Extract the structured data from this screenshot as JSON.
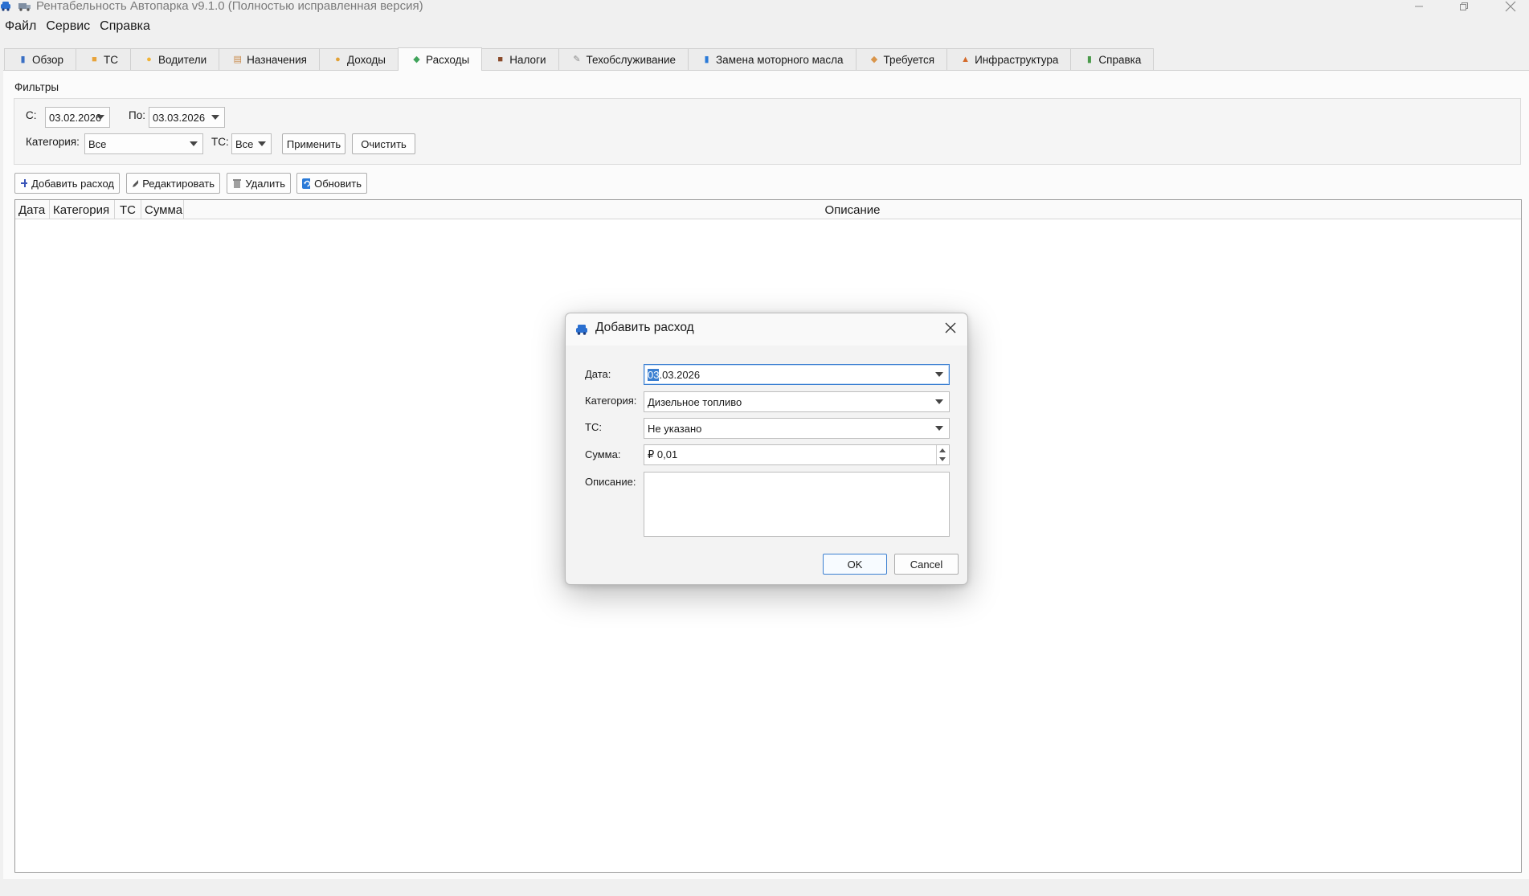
{
  "window": {
    "title": "Рентабельность Автопарка v9.1.0 (Полностью исправленная версия)"
  },
  "menu": [
    "Файл",
    "Сервис",
    "Справка"
  ],
  "tabs": [
    {
      "label": "Обзор",
      "icon": "chart-icon",
      "color": "#3a6fc4"
    },
    {
      "label": "ТС",
      "icon": "truck-icon",
      "color": "#e8a33a"
    },
    {
      "label": "Водители",
      "icon": "driver-face-icon",
      "color": "#f1b336"
    },
    {
      "label": "Назначения",
      "icon": "clipboard-icon",
      "color": "#c98a4a"
    },
    {
      "label": "Доходы",
      "icon": "money-bag-icon",
      "color": "#e2a237"
    },
    {
      "label": "Расходы",
      "icon": "money-wings-icon",
      "color": "#3fa35a"
    },
    {
      "label": "Налоги",
      "icon": "briefcase-icon",
      "color": "#8a4a2a"
    },
    {
      "label": "Техобслуживание",
      "icon": "wrench-icon",
      "color": "#8a8a8a"
    },
    {
      "label": "Замена моторного масла",
      "icon": "oil-can-icon",
      "color": "#2a7ad8"
    },
    {
      "label": "Требуется",
      "icon": "package-icon",
      "color": "#d9954a"
    },
    {
      "label": "Инфраструктура",
      "icon": "building-icon",
      "color": "#d46a2a"
    },
    {
      "label": "Справка",
      "icon": "books-icon",
      "color": "#4a9a4a"
    }
  ],
  "active_tab": 5,
  "filters": {
    "title": "Фильтры",
    "from_label": "С:",
    "from_value": "03.02.2026",
    "to_label": "По:",
    "to_value": "03.03.2026",
    "category_label": "Категория:",
    "category_value": "Все",
    "vehicle_label": "ТС:",
    "vehicle_value": "Все",
    "apply_label": "Применить",
    "clear_label": "Очистить"
  },
  "toolbar": {
    "add_label": "Добавить расход",
    "edit_label": "Редактировать",
    "delete_label": "Удалить",
    "refresh_label": "Обновить"
  },
  "table": {
    "columns": [
      "Дата",
      "Категория",
      "ТС",
      "Сумма",
      "Описание"
    ],
    "rows": []
  },
  "dialog": {
    "title": "Добавить расход",
    "date_label": "Дата:",
    "date_selected": "03",
    "date_rest": ".03.2026",
    "category_label": "Категория:",
    "category_value": "Дизельное топливо",
    "vehicle_label": "ТС:",
    "vehicle_value": "Не указано",
    "amount_label": "Сумма:",
    "amount_value": "₽ 0,01",
    "description_label": "Описание:",
    "description_value": "",
    "ok_label": "OK",
    "cancel_label": "Cancel"
  },
  "colors": {
    "accent": "#3b7fd1",
    "window_bg": "#f0f0f0"
  }
}
